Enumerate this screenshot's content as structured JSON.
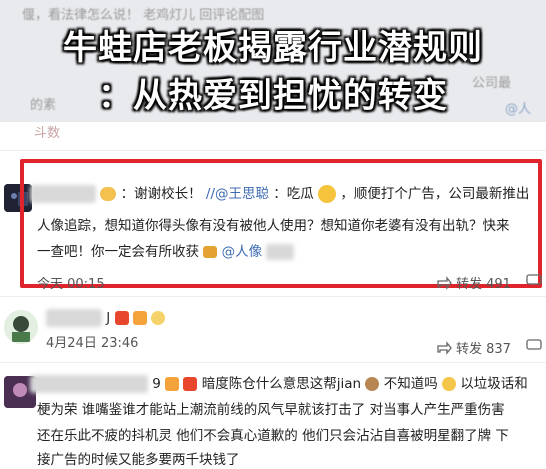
{
  "headline": {
    "line1": "牛蛙店老板揭露行业潜规则",
    "line2": "：从热爱到担忧的转变"
  },
  "background": {
    "top_snippet": "偃，看法律怎么说！  老鸡灯儿  回评论配图",
    "side_left": "的素",
    "side_right_1": "公司最",
    "side_right_2": "@人"
  },
  "feed": {
    "top_label": "斗数",
    "comment1": {
      "reply_prefix": "：谢谢校长！",
      "mention1": "//@王思聪",
      "text1": "：吃瓜",
      "text2": "，顺便打个广告，公司最新推出",
      "line2": "人像追踪，想知道你得头像有没有被他人使用？想知道你老婆有没有出轨？快来",
      "line3": "一查吧！你一定会有所收获",
      "mention2": "@人像",
      "time": "今天 00:15",
      "forward_label": "转发 491"
    },
    "comment2": {
      "nick_suffix": "J",
      "time": "4月24日 23:46",
      "forward_label": "转发 837"
    },
    "comment3": {
      "nick_suffix": "9",
      "line1": "暗度陈仓什么意思这帮jian",
      "line1b": "不知道吗",
      "line1c": "以垃圾话和",
      "line2": "梗为荣 谁嘴鉴谁才能站上潮流前线的风气早就该打击了 对当事人产生严重伤害",
      "line3": "还在乐此不疲的抖机灵 他们不会真心道歉的 他们只会沾沾自喜被明星翻了牌 下",
      "line4": "接广告的时候又能多要两千块钱了"
    }
  }
}
